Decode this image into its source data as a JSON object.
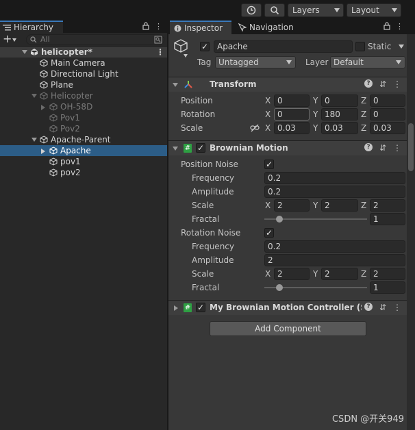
{
  "toolbar": {
    "layers": "Layers",
    "layout": "Layout"
  },
  "hierarchy": {
    "tab": "Hierarchy",
    "search_placeholder": "All",
    "items": [
      {
        "label": "helicopter*"
      },
      {
        "label": "Main Camera"
      },
      {
        "label": "Directional Light"
      },
      {
        "label": "Plane"
      },
      {
        "label": "Helicopter"
      },
      {
        "label": "OH-58D"
      },
      {
        "label": "Pov1"
      },
      {
        "label": "Pov2"
      },
      {
        "label": "Apache-Parent"
      },
      {
        "label": "Apache"
      },
      {
        "label": "pov1"
      },
      {
        "label": "pov2"
      }
    ]
  },
  "inspector": {
    "tab": "Inspector",
    "nav_tab": "Navigation",
    "object_name": "Apache",
    "static_label": "Static",
    "tag_label": "Tag",
    "tag_value": "Untagged",
    "layer_label": "Layer",
    "layer_value": "Default",
    "transform": {
      "title": "Transform",
      "position_label": "Position",
      "rotation_label": "Rotation",
      "scale_label": "Scale",
      "x": "X",
      "y": "Y",
      "z": "Z",
      "position": [
        "0",
        "0",
        "0"
      ],
      "rotation": [
        "0",
        "180",
        "0"
      ],
      "scale": [
        "0.03",
        "0.03",
        "0.03"
      ]
    },
    "brownian": {
      "title": "Brownian Motion",
      "position_noise": "Position Noise",
      "rotation_noise": "Rotation Noise",
      "frequency_label": "Frequency",
      "amplitude_label": "Amplitude",
      "scale_label": "Scale",
      "fractal_label": "Fractal",
      "pos_frequency": "0.2",
      "pos_amplitude": "0.2",
      "pos_scale": [
        "2",
        "2",
        "2"
      ],
      "pos_fractal": "1",
      "rot_frequency": "0.2",
      "rot_amplitude": "2",
      "rot_scale": [
        "2",
        "2",
        "2"
      ],
      "rot_fractal": "1"
    },
    "controller": {
      "title": "My Brownian Motion Controller (Script)"
    },
    "add_component": "Add Component"
  },
  "watermark": "CSDN @开关949"
}
